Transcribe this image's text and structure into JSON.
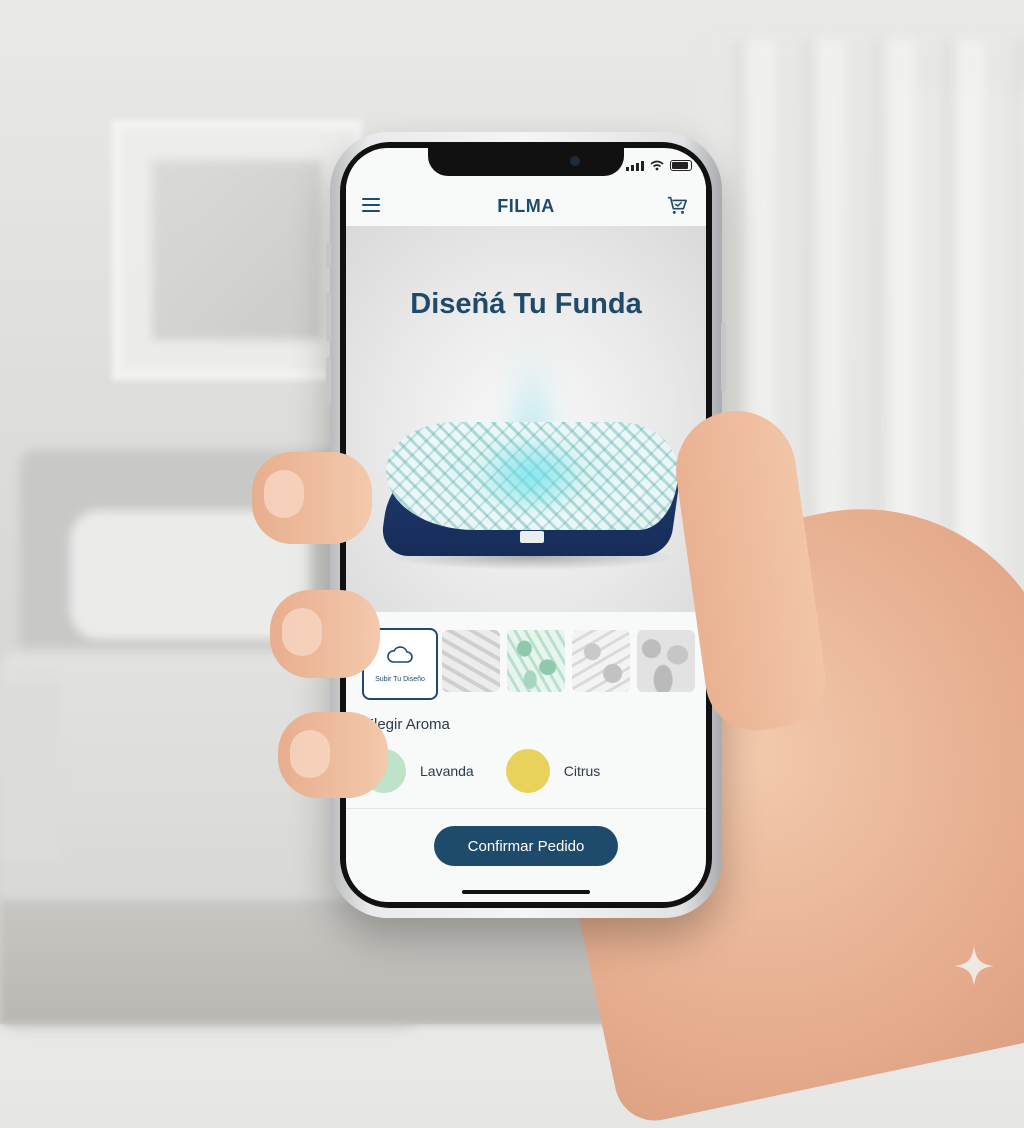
{
  "app": {
    "brand": "FILMA",
    "hero_title": "Diseñá Tu Funda"
  },
  "icons": {
    "menu": "hamburger-menu-icon",
    "cart": "cart-icon",
    "upload": "cloud-upload-icon",
    "signal": "signal-icon",
    "wifi": "wifi-icon",
    "battery": "battery-icon"
  },
  "designs": {
    "upload_label": "Subir Tu Diseño",
    "patterns": [
      {
        "name": "pattern-gray-leaves",
        "color": "#cfcfcf"
      },
      {
        "name": "pattern-green-leaves",
        "color": "#8fc9ad"
      },
      {
        "name": "pattern-gray-floral",
        "color": "#c9c9c9"
      },
      {
        "name": "pattern-gray-tropical",
        "color": "#bdbdbd"
      }
    ],
    "selected_index": 1
  },
  "aroma": {
    "title": "Elegir Aroma",
    "options": [
      {
        "label": "Lavanda",
        "color": "#bfe3c8"
      },
      {
        "label": "Citrus",
        "color": "#e8d25b"
      }
    ]
  },
  "actions": {
    "confirm_label": "Confirmar Pedido"
  },
  "colors": {
    "brand": "#1e4a6b",
    "pillow_base": "#1c3566",
    "pillow_pattern": "#3aa5a0"
  }
}
